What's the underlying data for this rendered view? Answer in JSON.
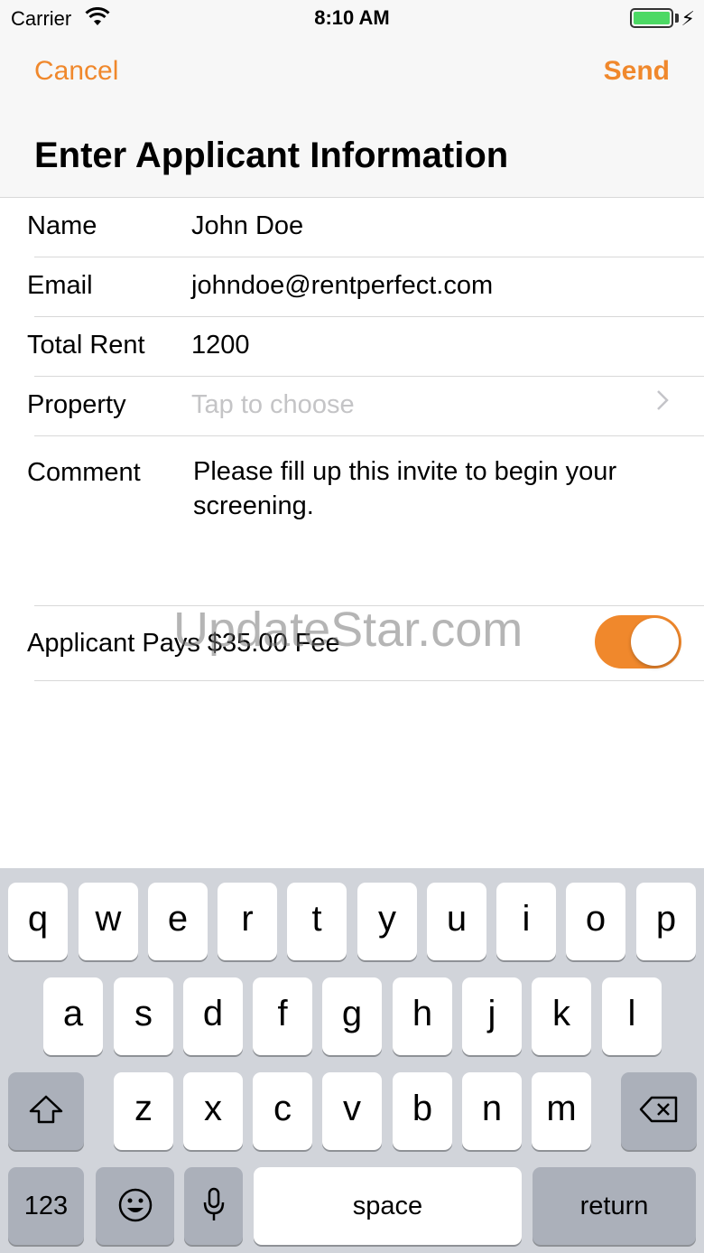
{
  "status_bar": {
    "carrier": "Carrier",
    "time": "8:10 AM"
  },
  "nav": {
    "cancel": "Cancel",
    "send": "Send",
    "title": "Enter Applicant Information"
  },
  "form": {
    "name_label": "Name",
    "name_value": "John Doe",
    "email_label": "Email",
    "email_value": "johndoe@rentperfect.com",
    "rent_label": "Total Rent",
    "rent_value": "1200",
    "property_label": "Property",
    "property_placeholder": "Tap to choose",
    "comment_label": "Comment",
    "comment_value": "Please fill up this invite to begin your screening.",
    "fee_label": "Applicant Pays $35.00 Fee",
    "fee_toggle_on": true
  },
  "watermark": "UpdateStar.com",
  "keyboard": {
    "row1": [
      "q",
      "w",
      "e",
      "r",
      "t",
      "y",
      "u",
      "i",
      "o",
      "p"
    ],
    "row2": [
      "a",
      "s",
      "d",
      "f",
      "g",
      "h",
      "j",
      "k",
      "l"
    ],
    "row3": [
      "z",
      "x",
      "c",
      "v",
      "b",
      "n",
      "m"
    ],
    "numbers": "123",
    "space": "space",
    "return": "return"
  },
  "colors": {
    "accent": "#f0882c",
    "keyboard_bg": "#d1d4da"
  }
}
